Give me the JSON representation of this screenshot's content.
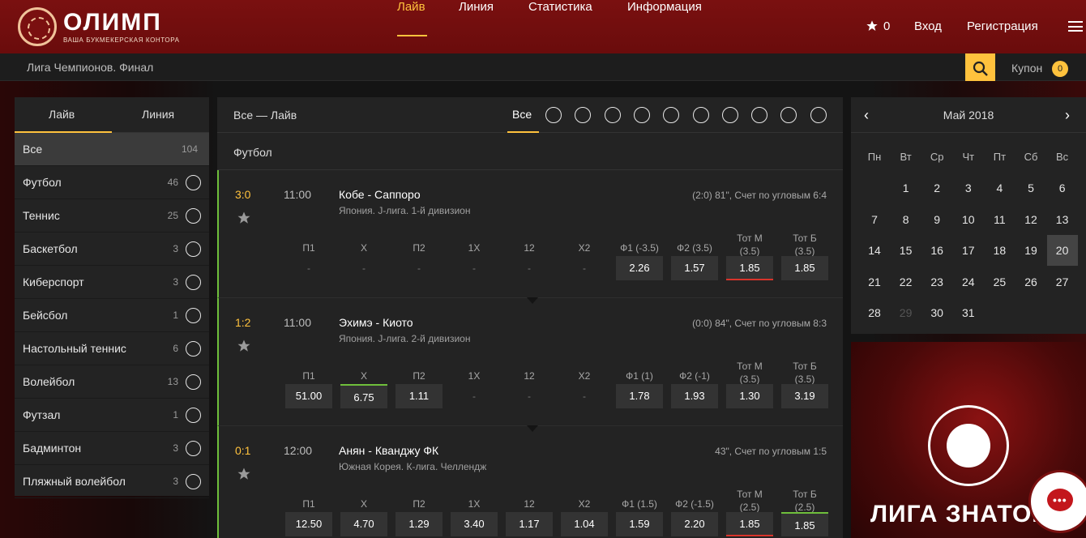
{
  "header": {
    "logo_name": "ОЛИМП",
    "logo_sub": "ВАША БУКМЕКЕРСКАЯ КОНТОРА",
    "nav": [
      {
        "label": "Лайв",
        "active": true
      },
      {
        "label": "Линия",
        "active": false
      },
      {
        "label": "Статистика",
        "active": false
      },
      {
        "label": "Информация",
        "active": false
      }
    ],
    "favorites_count": "0",
    "login": "Вход",
    "register": "Регистрация"
  },
  "subbar": {
    "breadcrumb": "Лига Чемпионов. Финал",
    "coupon_label": "Купон",
    "coupon_count": "0"
  },
  "sidebar": {
    "tabs": [
      "Лайв",
      "Линия"
    ],
    "items": [
      {
        "label": "Все",
        "count": "104",
        "icon": "none"
      },
      {
        "label": "Футбол",
        "count": "46",
        "icon": "soccer-ball-icon"
      },
      {
        "label": "Теннис",
        "count": "25",
        "icon": "tennis-ball-icon"
      },
      {
        "label": "Баскетбол",
        "count": "3",
        "icon": "basketball-icon"
      },
      {
        "label": "Киберспорт",
        "count": "3",
        "icon": "gamepad-icon"
      },
      {
        "label": "Бейсбол",
        "count": "1",
        "icon": "baseball-bat-icon"
      },
      {
        "label": "Настольный теннис",
        "count": "6",
        "icon": "ping-pong-icon"
      },
      {
        "label": "Волейбол",
        "count": "13",
        "icon": "volleyball-icon"
      },
      {
        "label": "Футзал",
        "count": "1",
        "icon": "futsal-player-icon"
      },
      {
        "label": "Бадминтон",
        "count": "3",
        "icon": "shuttlecock-icon"
      },
      {
        "label": "Пляжный волейбол",
        "count": "3",
        "icon": "beach-volley-icon"
      }
    ]
  },
  "center": {
    "title": "Все — Лайв",
    "filter_all": "Все",
    "sport_filters": [
      "soccer-ball-icon",
      "tennis-ball-icon",
      "basketball-icon",
      "gamepad-icon",
      "baseball-bat-icon",
      "ping-pong-icon",
      "volleyball-icon",
      "futsal-player-icon",
      "shuttlecock-icon",
      "beach-volley-icon"
    ],
    "section": "Футбол",
    "matches": [
      {
        "score": "3:0",
        "time": "11:00",
        "teams": "Кобе - Саппоро",
        "league": "Япония. J-лига. 1-й дивизион",
        "info": "(2:0) 81\", Счет по угловым 6:4",
        "odds": [
          {
            "h1": "П1",
            "h2": "",
            "v": "-"
          },
          {
            "h1": "Х",
            "h2": "",
            "v": "-"
          },
          {
            "h1": "П2",
            "h2": "",
            "v": "-"
          },
          {
            "h1": "1Х",
            "h2": "",
            "v": "-"
          },
          {
            "h1": "12",
            "h2": "",
            "v": "-"
          },
          {
            "h1": "Х2",
            "h2": "",
            "v": "-"
          },
          {
            "h1": "Ф1 (-3.5)",
            "h2": "",
            "v": "2.26"
          },
          {
            "h1": "Ф2 (3.5)",
            "h2": "",
            "v": "1.57"
          },
          {
            "h1": "Тот М",
            "h2": "(3.5)",
            "v": "1.85",
            "mark": "red"
          },
          {
            "h1": "Тот Б",
            "h2": "(3.5)",
            "v": "1.85"
          }
        ]
      },
      {
        "score": "1:2",
        "time": "11:00",
        "teams": "Эхимэ - Киото",
        "league": "Япония. J-лига. 2-й дивизион",
        "info": "(0:0) 84\", Счет по угловым 8:3",
        "odds": [
          {
            "h1": "П1",
            "h2": "",
            "v": "51.00"
          },
          {
            "h1": "Х",
            "h2": "",
            "v": "6.75",
            "mark": "green"
          },
          {
            "h1": "П2",
            "h2": "",
            "v": "1.11"
          },
          {
            "h1": "1Х",
            "h2": "",
            "v": "-"
          },
          {
            "h1": "12",
            "h2": "",
            "v": "-"
          },
          {
            "h1": "Х2",
            "h2": "",
            "v": "-"
          },
          {
            "h1": "Ф1 (1)",
            "h2": "",
            "v": "1.78"
          },
          {
            "h1": "Ф2 (-1)",
            "h2": "",
            "v": "1.93"
          },
          {
            "h1": "Тот М",
            "h2": "(3.5)",
            "v": "1.30"
          },
          {
            "h1": "Тот Б",
            "h2": "(3.5)",
            "v": "3.19"
          }
        ]
      },
      {
        "score": "0:1",
        "time": "12:00",
        "teams": "Анян - Кванджу ФК",
        "league": "Южная Корея. К-лига. Челлендж",
        "info": "43\", Счет по угловым 1:5",
        "odds": [
          {
            "h1": "П1",
            "h2": "",
            "v": "12.50"
          },
          {
            "h1": "Х",
            "h2": "",
            "v": "4.70"
          },
          {
            "h1": "П2",
            "h2": "",
            "v": "1.29"
          },
          {
            "h1": "1Х",
            "h2": "",
            "v": "3.40"
          },
          {
            "h1": "12",
            "h2": "",
            "v": "1.17"
          },
          {
            "h1": "Х2",
            "h2": "",
            "v": "1.04"
          },
          {
            "h1": "Ф1 (1.5)",
            "h2": "",
            "v": "1.59"
          },
          {
            "h1": "Ф2 (-1.5)",
            "h2": "",
            "v": "2.20"
          },
          {
            "h1": "Тот М",
            "h2": "(2.5)",
            "v": "1.85",
            "mark": "red"
          },
          {
            "h1": "Тот Б",
            "h2": "(2.5)",
            "v": "1.85",
            "mark": "green"
          }
        ]
      }
    ]
  },
  "calendar": {
    "title": "Май 2018",
    "dow": [
      "Пн",
      "Вт",
      "Ср",
      "Чт",
      "Пт",
      "Сб",
      "Вс"
    ],
    "weeks": [
      [
        "",
        "1",
        "2",
        "3",
        "4",
        "5",
        "6"
      ],
      [
        "7",
        "8",
        "9",
        "10",
        "11",
        "12",
        "13"
      ],
      [
        "14",
        "15",
        "16",
        "17",
        "18",
        "19",
        "20"
      ],
      [
        "21",
        "22",
        "23",
        "24",
        "25",
        "26",
        "27"
      ],
      [
        "28",
        "29",
        "30",
        "31",
        "",
        "",
        ""
      ]
    ],
    "today": "20",
    "muted": [
      "29"
    ]
  },
  "promo": {
    "text": "ЛИГА ЗНАТОК"
  },
  "colors": {
    "brand_red": "#7a1010",
    "accent_yellow": "#ffc23d",
    "live_green": "#6fbf3b",
    "down_red": "#d9342b"
  }
}
